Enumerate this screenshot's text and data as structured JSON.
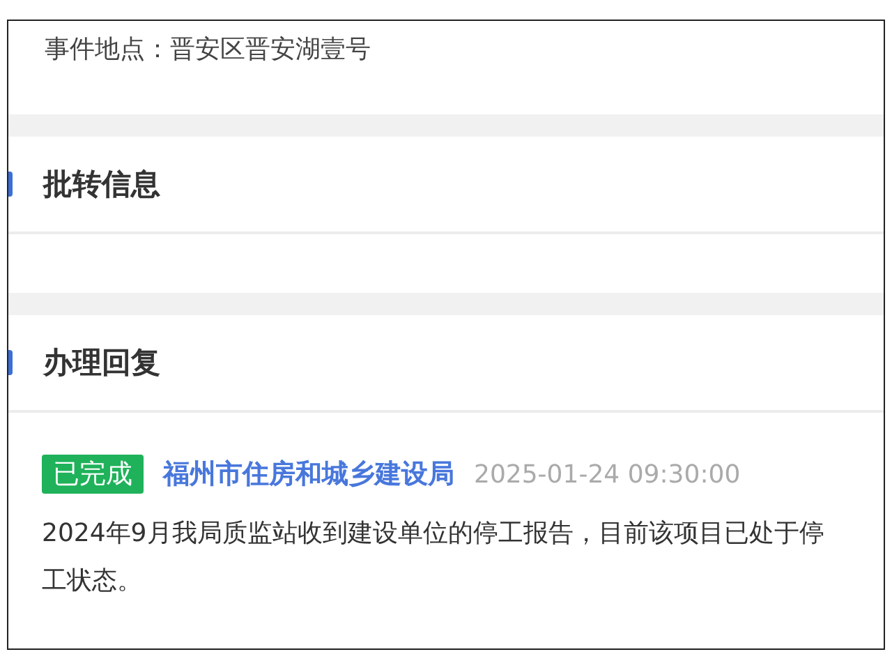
{
  "location_line": "事件地点：晋安区晋安湖壹号",
  "sections": [
    {
      "title": "批转信息"
    },
    {
      "title": "办理回复",
      "replies": [
        {
          "status": {
            "label": "已完成",
            "color": "#1fb25a"
          },
          "department": "福州市住房和城乡建设局",
          "time": "2025-01-24 09:30:00",
          "content": "2024年9月我局质监站收到建设单位的停工报告，目前该项目已处于停工状态。"
        }
      ]
    }
  ]
}
